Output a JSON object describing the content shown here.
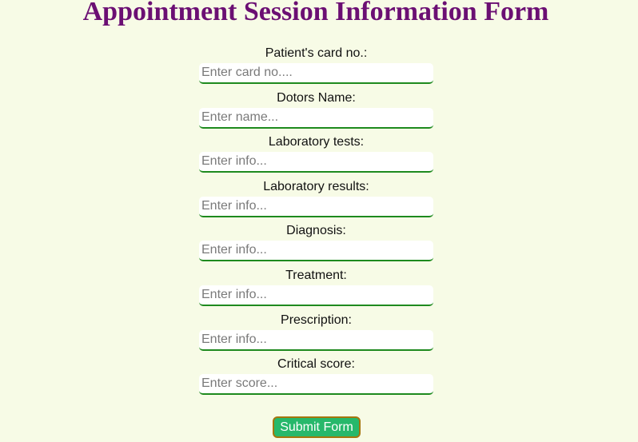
{
  "page": {
    "title": "Appointment Session Information Form"
  },
  "form": {
    "fields": [
      {
        "label": "Patient's card no.:",
        "placeholder": "Enter card no....",
        "value": ""
      },
      {
        "label": "Dotors Name:",
        "placeholder": "Enter name...",
        "value": ""
      },
      {
        "label": "Laboratory tests:",
        "placeholder": "Enter info...",
        "value": ""
      },
      {
        "label": "Laboratory results:",
        "placeholder": "Enter info...",
        "value": ""
      },
      {
        "label": "Diagnosis:",
        "placeholder": "Enter info...",
        "value": ""
      },
      {
        "label": "Treatment:",
        "placeholder": "Enter info...",
        "value": ""
      },
      {
        "label": "Prescription:",
        "placeholder": "Enter info...",
        "value": ""
      },
      {
        "label": "Critical score:",
        "placeholder": "Enter score...",
        "value": ""
      }
    ],
    "submit_label": "Submit Form"
  },
  "colors": {
    "background": "#f7fbe6",
    "title": "#6b0f73",
    "input_border": "#1e8a1e",
    "submit_bg": "#27b86b",
    "submit_border": "#a5760e"
  }
}
